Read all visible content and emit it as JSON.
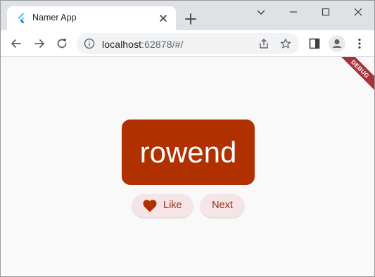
{
  "browser": {
    "tab": {
      "title": "Namer App",
      "favicon": "flutter-icon"
    },
    "new_tab_icon": "plus-icon",
    "window_controls": [
      "chevron-down-icon",
      "minimize-icon",
      "maximize-icon",
      "close-icon"
    ],
    "address": {
      "host": "localhost",
      "rest": ":62878/#/"
    }
  },
  "app": {
    "debug_banner": "DEBUG",
    "word": "rowend",
    "like_label": "Like",
    "next_label": "Next",
    "colors": {
      "card": "#b13000",
      "button_bg": "#f5e5e7",
      "button_text": "#9d2a14",
      "background": "#f9f9f9"
    }
  }
}
